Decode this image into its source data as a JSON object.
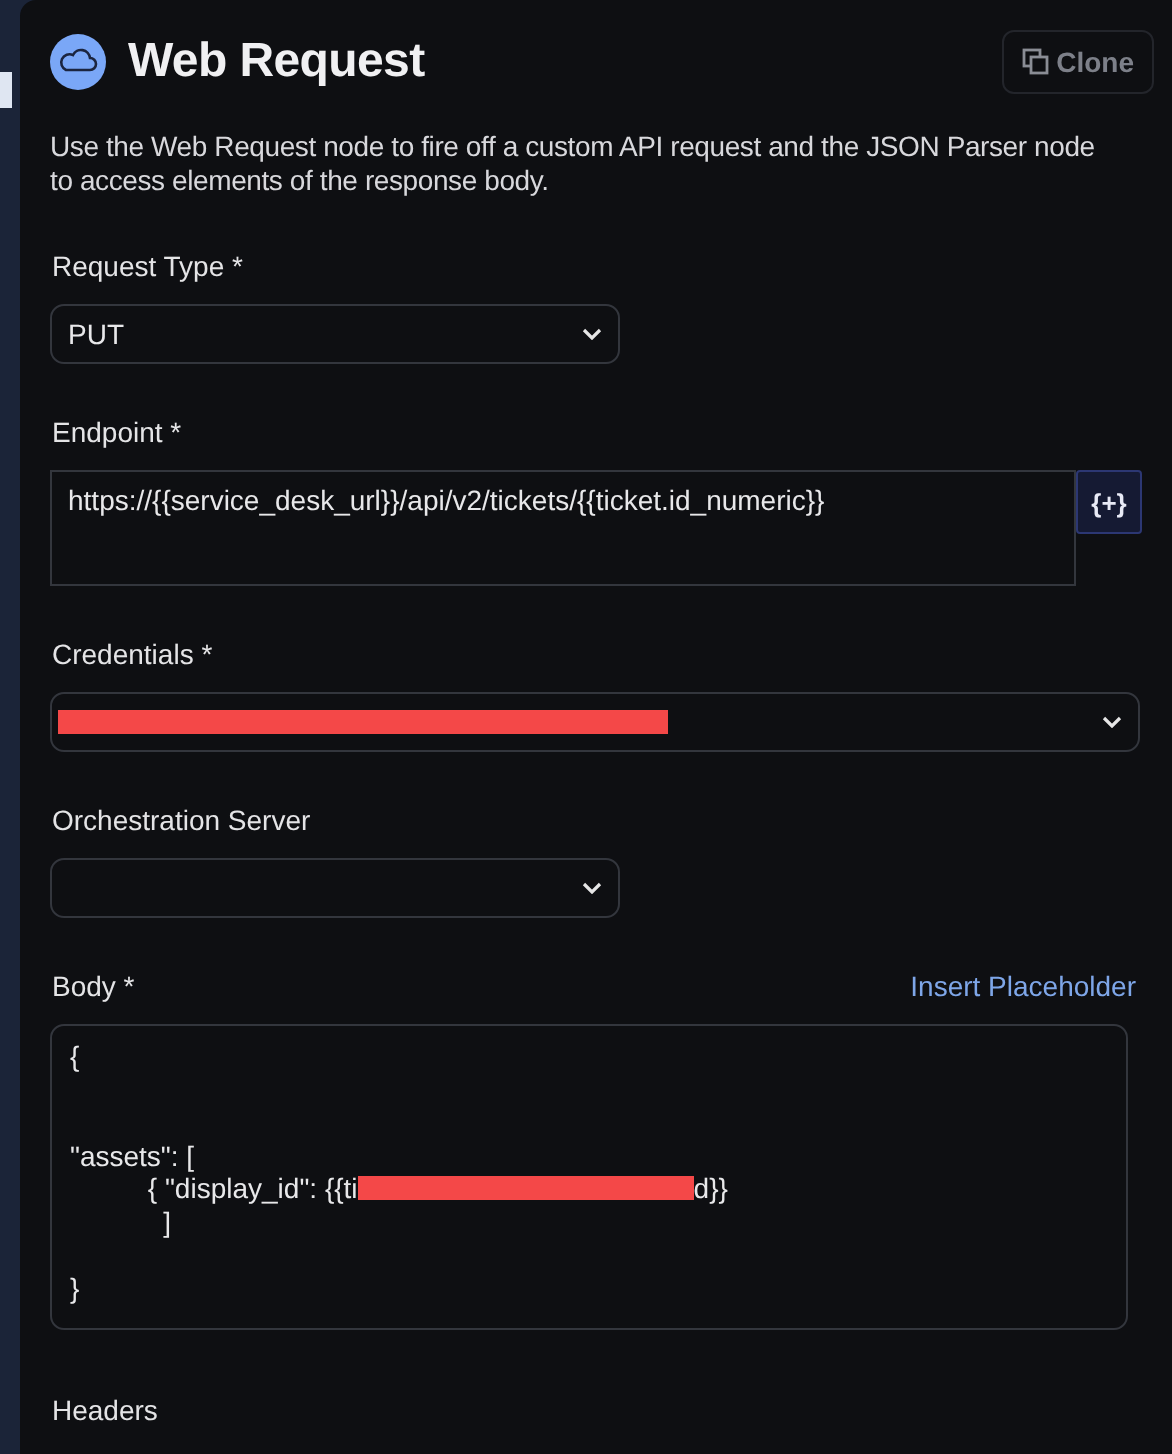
{
  "header": {
    "title": "Web Request",
    "clone_button": "Clone"
  },
  "description": "Use the Web Request node to fire off a custom API request and the JSON Parser node to access elements of the response body.",
  "fields": [
    {
      "kind": "select",
      "label": "Request Type *",
      "value": "PUT",
      "wide": false
    },
    {
      "kind": "textarea",
      "label": "Endpoint *",
      "value": "https://{{service_desk_url}}/api/v2/tickets/{{ticket.id_numeric}}",
      "insert_button": "{+}"
    },
    {
      "kind": "select",
      "label": "Credentials *",
      "redacted": true,
      "wide": true
    },
    {
      "kind": "select",
      "label": "Orchestration Server",
      "wide": false
    },
    {
      "kind": "code",
      "label": "Body *",
      "link": "Insert Placeholder",
      "lines": [
        {
          "kind": "text",
          "text": "{"
        },
        {
          "kind": "blank"
        },
        {
          "kind": "blank"
        },
        {
          "kind": "text",
          "text": "\"assets\": ["
        },
        {
          "kind": "text",
          "text": "          { \"display_id\": {{ti",
          "redacted": true,
          "after": "d}}"
        },
        {
          "kind": "text",
          "text": "            ]"
        },
        {
          "kind": "blank"
        },
        {
          "text": "}",
          "kind": "text"
        }
      ]
    },
    {
      "kind": "heading",
      "label": "Headers"
    }
  ]
}
